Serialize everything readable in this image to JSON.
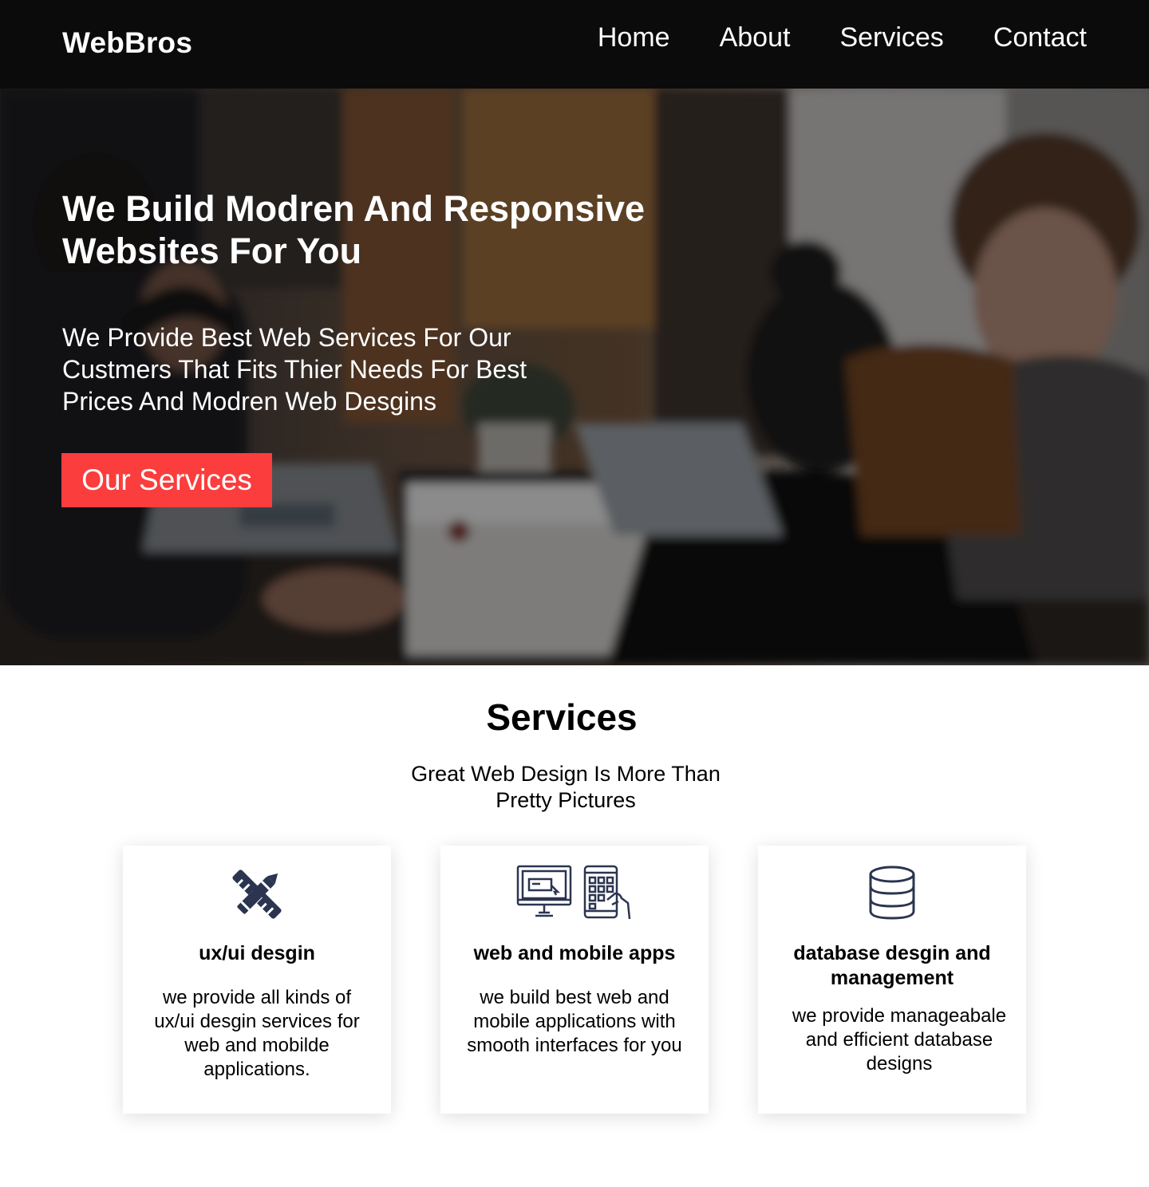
{
  "navbar": {
    "brand": "WebBros",
    "links": [
      "Home",
      "About",
      "Services",
      "Contact"
    ]
  },
  "hero": {
    "title": "We Build Modren And Responsive Websites For You",
    "subtitle": "We Provide Best Web Services For Our Custmers That Fits Thier Needs For Best Prices And Modren Web Desgins",
    "cta_label": "Our Services"
  },
  "services": {
    "title": "Services",
    "subtitle_line1": "Great Web Design Is More Than",
    "subtitle_line2": "Pretty Pictures",
    "cards": [
      {
        "icon": "pencil-ruler-icon",
        "title": "ux/ui desgin",
        "text": "we provide all kinds of ux/ui desgin services for web and mobilde applications."
      },
      {
        "icon": "desktop-mobile-icon",
        "title": "web and mobile apps",
        "text": "we build best web and mobile applications with smooth interfaces for you"
      },
      {
        "icon": "database-icon",
        "title": "database desgin and management",
        "text": "we provide manageabale and efficient database designs"
      }
    ]
  },
  "colors": {
    "navbar_bg": "#0b0b0b",
    "accent": "#fb3d3d",
    "icon": "#2b3550"
  }
}
